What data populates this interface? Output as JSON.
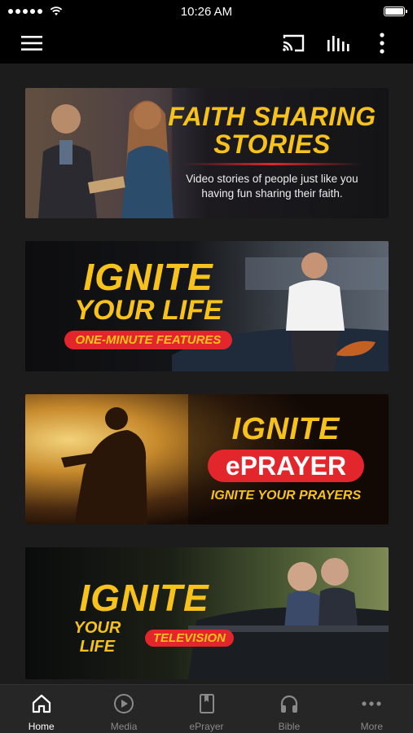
{
  "status": {
    "time": "10:26 AM"
  },
  "toolbar": {
    "menu_icon": "hamburger-menu-icon",
    "cast_icon": "cast-icon",
    "audio_icon": "equalizer-icon",
    "more_icon": "vertical-dots-icon"
  },
  "cards": [
    {
      "title_line1": "FAITH SHARING",
      "title_line2": "STORIES",
      "subtitle_line1": "Video stories of people just like you",
      "subtitle_line2": "having fun sharing their faith."
    },
    {
      "title_line1": "IGNITE",
      "title_line2": "YOUR LIFE",
      "badge": "ONE-MINUTE FEATURES"
    },
    {
      "title_line1": "IGNITE",
      "badge": "ePRAYER",
      "tagline": "IGNITE YOUR PRAYERS"
    },
    {
      "title_line1": "IGNITE",
      "title_line2": "YOUR LIFE",
      "badge": "TELEVISION"
    }
  ],
  "tabs": [
    {
      "label": "Home",
      "icon": "home-icon",
      "active": true
    },
    {
      "label": "Media",
      "icon": "play-circle-icon",
      "active": false
    },
    {
      "label": "ePrayer",
      "icon": "bookmark-book-icon",
      "active": false
    },
    {
      "label": "Bible",
      "icon": "headphones-icon",
      "active": false
    },
    {
      "label": "More",
      "icon": "more-dots-icon",
      "active": false
    }
  ],
  "colors": {
    "accent_yellow": "#f7c21b",
    "badge_red": "#e2262b",
    "background": "#1c1c1c"
  }
}
